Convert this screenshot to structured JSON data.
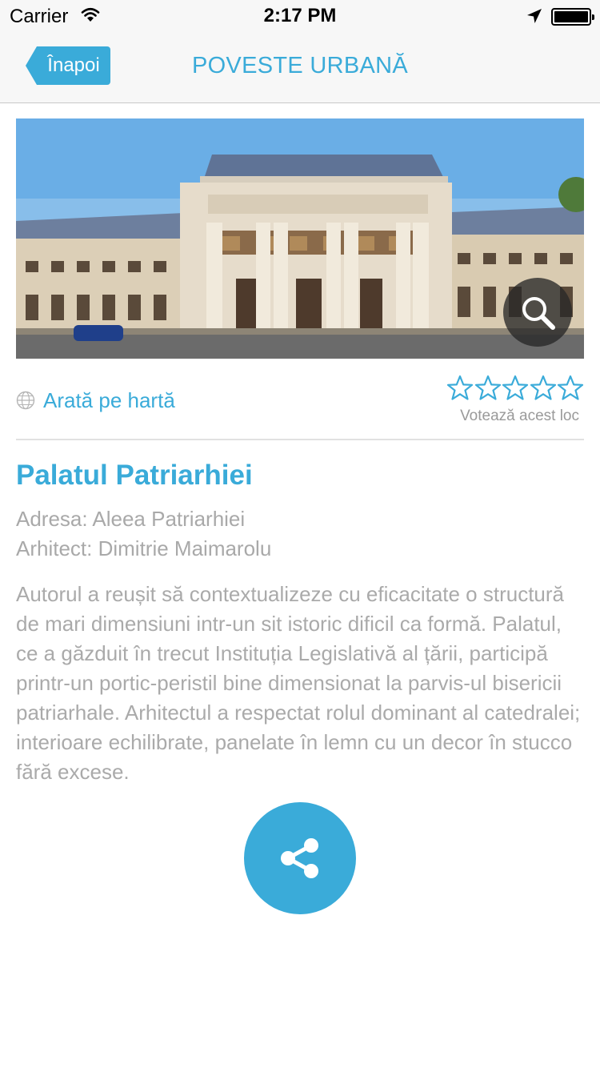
{
  "status_bar": {
    "carrier": "Carrier",
    "time": "2:17 PM",
    "icons": [
      "wifi-icon",
      "location-arrow-icon",
      "battery-icon"
    ]
  },
  "nav": {
    "back_label": "Înapoi",
    "title": "POVESTE URBANĂ"
  },
  "hero": {
    "subject": "Palatul Patriarhiei building photo",
    "zoom_icon": "magnifier-icon"
  },
  "map_link": {
    "icon": "globe-icon",
    "label": "Arată pe hartă"
  },
  "rating": {
    "stars_total": 5,
    "stars_filled": 0,
    "vote_label": "Votează acest loc"
  },
  "place": {
    "name": "Palatul Patriarhiei",
    "address": "Adresa: Aleea Patriarhiei",
    "architect": "Arhitect: Dimitrie Maimarolu",
    "description": "Autorul a reușit să contextualizeze cu eficacitate o structură de mari dimensiuni intr-un sit istoric dificil ca formă. Palatul, ce a găzduit în trecut Instituția Legislativă al țării,  participă printr-un portic-peristil bine dimensionat la parvis-ul bisericii patriarhale. Arhitectul a respectat rolul dominant al catedralei; interioare echilibrate, panelate în lemn cu un decor în stucco fără excese."
  },
  "share": {
    "icon": "share-icon"
  },
  "colors": {
    "accent": "#3aabd9",
    "text_muted": "#aaaaaa",
    "nav_bg": "#f7f7f7"
  }
}
